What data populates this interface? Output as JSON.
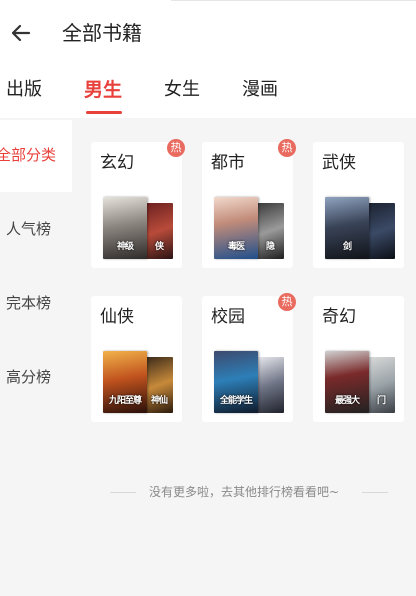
{
  "header": {
    "title": "全部书籍",
    "back_icon": "arrow-left-icon"
  },
  "tabs": [
    {
      "label": "出版",
      "active": false
    },
    {
      "label": "男生",
      "active": true
    },
    {
      "label": "女生",
      "active": false
    },
    {
      "label": "漫画",
      "active": false
    }
  ],
  "sidebar": {
    "items": [
      {
        "label": "全部分类",
        "active": true
      },
      {
        "label": "人气榜",
        "active": false
      },
      {
        "label": "完本榜",
        "active": false
      },
      {
        "label": "高分榜",
        "active": false
      }
    ]
  },
  "categories": [
    {
      "name": "玄幻",
      "hot": true,
      "badge": "热",
      "front_text": "神级",
      "back_text": "侠"
    },
    {
      "name": "都市",
      "hot": true,
      "badge": "热",
      "front_text": "毒医",
      "back_text": "隐"
    },
    {
      "name": "武侠",
      "hot": false,
      "badge": "",
      "front_text": "剑",
      "back_text": ""
    },
    {
      "name": "仙侠",
      "hot": false,
      "badge": "",
      "front_text": "九阳至尊",
      "back_text": "神仙"
    },
    {
      "name": "校园",
      "hot": true,
      "badge": "热",
      "front_text": "全能学生",
      "back_text": ""
    },
    {
      "name": "奇幻",
      "hot": false,
      "badge": "",
      "front_text": "最强大",
      "back_text": "门"
    }
  ],
  "footer": {
    "note": "没有更多啦，去其他排行榜看看吧~"
  },
  "colors": {
    "accent": "#e8413c",
    "badge": "#e96a5f",
    "sidebar_bg": "#f5f5f5"
  }
}
